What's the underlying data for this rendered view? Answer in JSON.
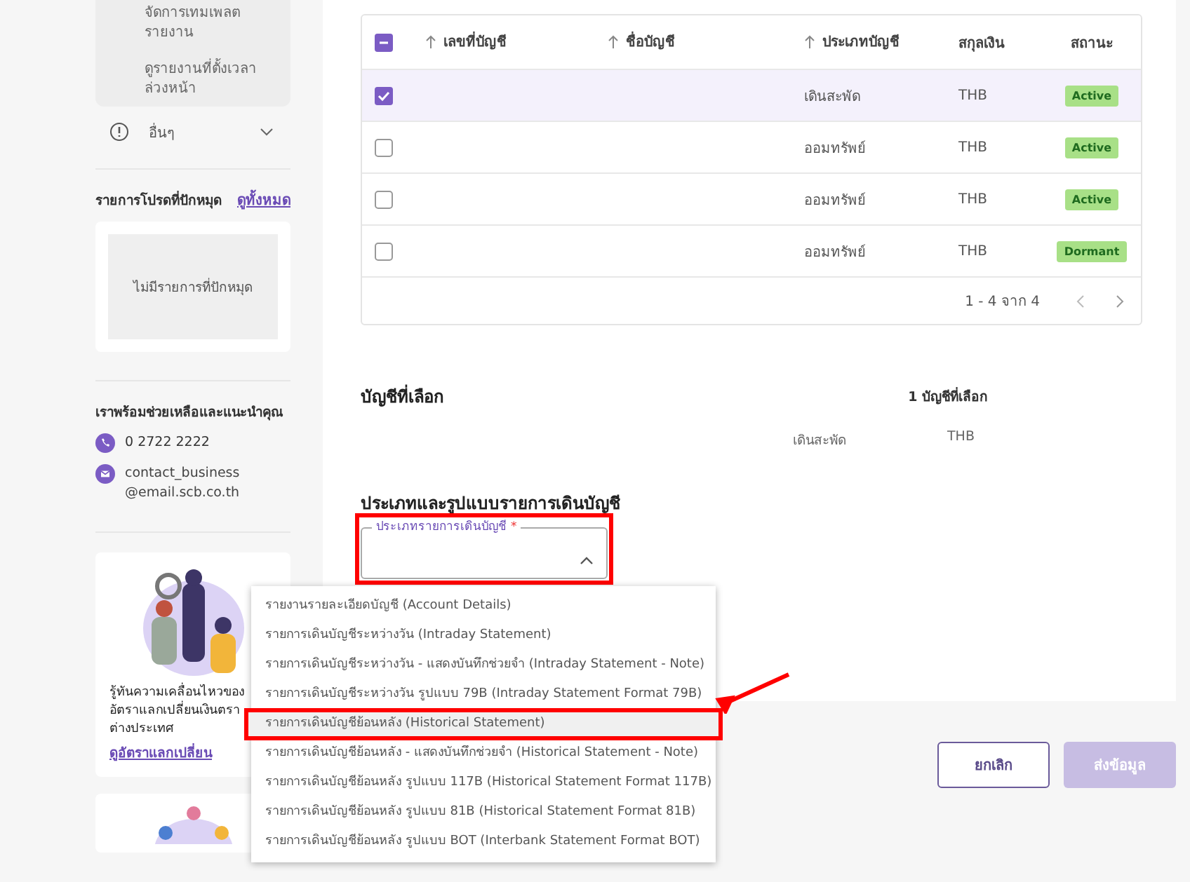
{
  "sidebar": {
    "menu_items": [
      "จัดการเทมเพลตรายงาน",
      "ดูรายงานที่ตั้งเวลาล่วงหน้า"
    ],
    "other_menu": {
      "label": "อื่นๆ",
      "expanded": false
    },
    "pinned": {
      "title": "รายการโปรดที่ปักหมุด",
      "view_all": "ดูทั้งหมด",
      "empty_text": "ไม่มีรายการที่ปักหมุด"
    },
    "help": {
      "title": "เราพร้อมช่วยเหลือและแนะนำคุณ",
      "phone": "0 2722 2222",
      "email": "contact_business@email.scb.co.th"
    },
    "promo": {
      "text": "รู้ทันความเคลื่อนไหวของอัตราแลกเปลี่ยนเงินตราต่างประเทศ",
      "link": "ดูอัตราแลกเปลี่ยน"
    }
  },
  "table": {
    "header_checkbox": {
      "indeterminate": true
    },
    "columns": [
      {
        "label": "เลขที่บัญชี",
        "sortable": true
      },
      {
        "label": "ชื่อบัญชี",
        "sortable": true
      },
      {
        "label": "ประเภทบัญชี",
        "sortable": true
      },
      {
        "label": "สกุลเงิน",
        "sortable": false
      },
      {
        "label": "สถานะ",
        "sortable": false
      }
    ],
    "rows": [
      {
        "checked": true,
        "selected": true,
        "type": "เดินสะพัด",
        "currency": "THB",
        "status": "Active"
      },
      {
        "checked": false,
        "selected": false,
        "type": "ออมทรัพย์",
        "currency": "THB",
        "status": "Active"
      },
      {
        "checked": false,
        "selected": false,
        "type": "ออมทรัพย์",
        "currency": "THB",
        "status": "Active"
      },
      {
        "checked": false,
        "selected": false,
        "type": "ออมทรัพย์",
        "currency": "THB",
        "status": "Dormant"
      }
    ],
    "pagination": "1 - 4 จาก 4"
  },
  "selected_accounts": {
    "title": "บัญชีที่เลือก",
    "count": "1 บัญชีที่เลือก",
    "rows": [
      {
        "type": "เดินสะพัด",
        "currency": "THB"
      }
    ]
  },
  "statement": {
    "title": "ประเภทและรูปแบบรายการเดินบัญชี",
    "field": {
      "label": "ประเภทรายการเดินบัญชี",
      "required_mark": "*",
      "expanded": true,
      "annotated": true
    },
    "options": [
      {
        "label": "รายงานรายละเอียดบัญชี (Account Details)",
        "highlighted": false
      },
      {
        "label": "รายการเดินบัญชีระหว่างวัน (Intraday Statement)",
        "highlighted": false
      },
      {
        "label": "รายการเดินบัญชีระหว่างวัน - แสดงบันทึกช่วยจำ (Intraday Statement - Note)",
        "highlighted": false
      },
      {
        "label": "รายการเดินบัญชีระหว่างวัน รูปแบบ 79B (Intraday Statement Format 79B)",
        "highlighted": false
      },
      {
        "label": "รายการเดินบัญชีย้อนหลัง (Historical Statement)",
        "highlighted": true
      },
      {
        "label": "รายการเดินบัญชีย้อนหลัง - แสดงบันทึกช่วยจำ (Historical Statement - Note)",
        "highlighted": false
      },
      {
        "label": "รายการเดินบัญชีย้อนหลัง รูปแบบ 117B (Historical Statement Format 117B)",
        "highlighted": false
      },
      {
        "label": "รายการเดินบัญชีย้อนหลัง รูปแบบ 81B (Historical Statement Format 81B)",
        "highlighted": false
      },
      {
        "label": "รายการเดินบัญชีย้อนหลัง รูปแบบ BOT (Interbank Statement Format BOT)",
        "highlighted": false
      }
    ]
  },
  "buttons": [
    {
      "label": "ยกเลิก",
      "kind": "secondary",
      "disabled": false
    },
    {
      "label": "ส่งข้อมูล",
      "kind": "primary",
      "disabled": true
    }
  ]
}
